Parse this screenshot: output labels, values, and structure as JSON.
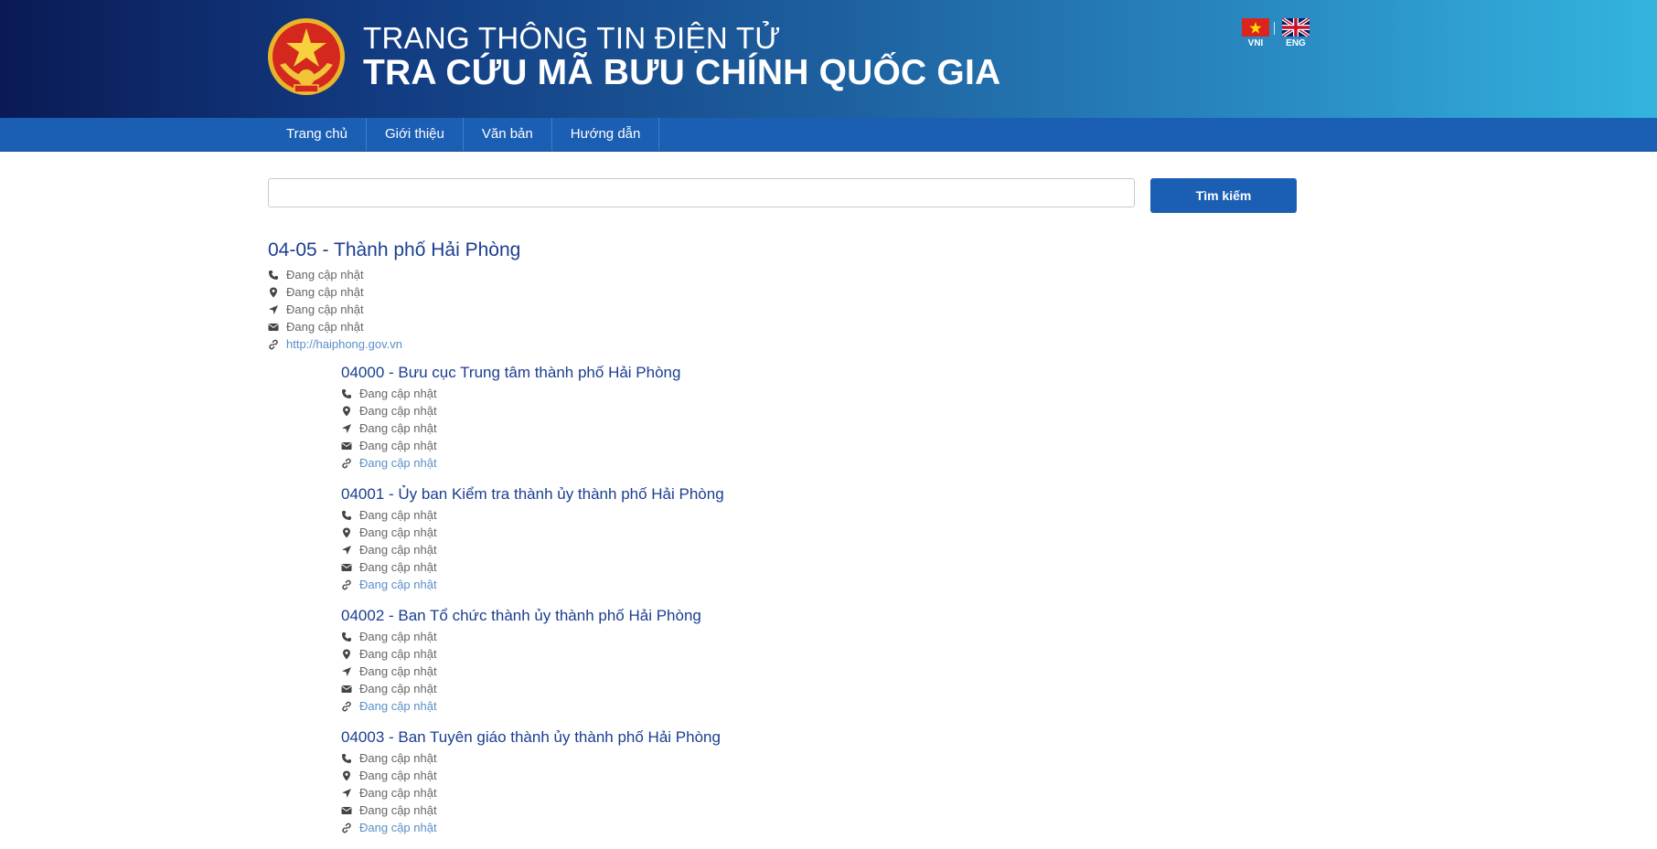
{
  "header": {
    "subtitle": "TRANG THÔNG TIN ĐIỆN TỬ",
    "title": "TRA CỨU MÃ BƯU CHÍNH QUỐC GIA",
    "languages": [
      {
        "code": "VNI"
      },
      {
        "code": "ENG"
      }
    ]
  },
  "nav": {
    "items": [
      {
        "label": "Trang chủ"
      },
      {
        "label": "Giới thiệu"
      },
      {
        "label": "Văn bản"
      },
      {
        "label": "Hướng dẫn"
      }
    ]
  },
  "search": {
    "value": "",
    "placeholder": "",
    "button_label": "Tìm kiếm"
  },
  "result": {
    "title": "04-05 - Thành phố Hải Phòng",
    "phone": "Đang cập nhật",
    "address": "Đang cập nhật",
    "location": "Đang cập nhật",
    "email": "Đang cập nhật",
    "website": "http://haiphong.gov.vn",
    "children": [
      {
        "title": "04000 - Bưu cục Trung tâm thành phố Hải Phòng",
        "phone": "Đang cập nhật",
        "address": "Đang cập nhật",
        "location": "Đang cập nhật",
        "email": "Đang cập nhật",
        "website": "Đang cập nhật"
      },
      {
        "title": "04001 - Ủy ban Kiểm tra thành ủy thành phố Hải Phòng",
        "phone": "Đang cập nhật",
        "address": "Đang cập nhật",
        "location": "Đang cập nhật",
        "email": "Đang cập nhật",
        "website": "Đang cập nhật"
      },
      {
        "title": "04002 - Ban Tổ chức thành ủy thành phố Hải Phòng",
        "phone": "Đang cập nhật",
        "address": "Đang cập nhật",
        "location": "Đang cập nhật",
        "email": "Đang cập nhật",
        "website": "Đang cập nhật"
      },
      {
        "title": "04003 - Ban Tuyên giáo thành ủy thành phố Hải Phòng",
        "phone": "Đang cập nhật",
        "address": "Đang cập nhật",
        "location": "Đang cập nhật",
        "email": "Đang cập nhật",
        "website": "Đang cập nhật"
      }
    ]
  },
  "colors": {
    "primary": "#1b5fb5",
    "title_blue": "#1b3e91",
    "link_blue": "#5a8fc9"
  },
  "icons": [
    "phone-icon",
    "map-marker-icon",
    "location-arrow-icon",
    "envelope-icon",
    "link-icon"
  ]
}
